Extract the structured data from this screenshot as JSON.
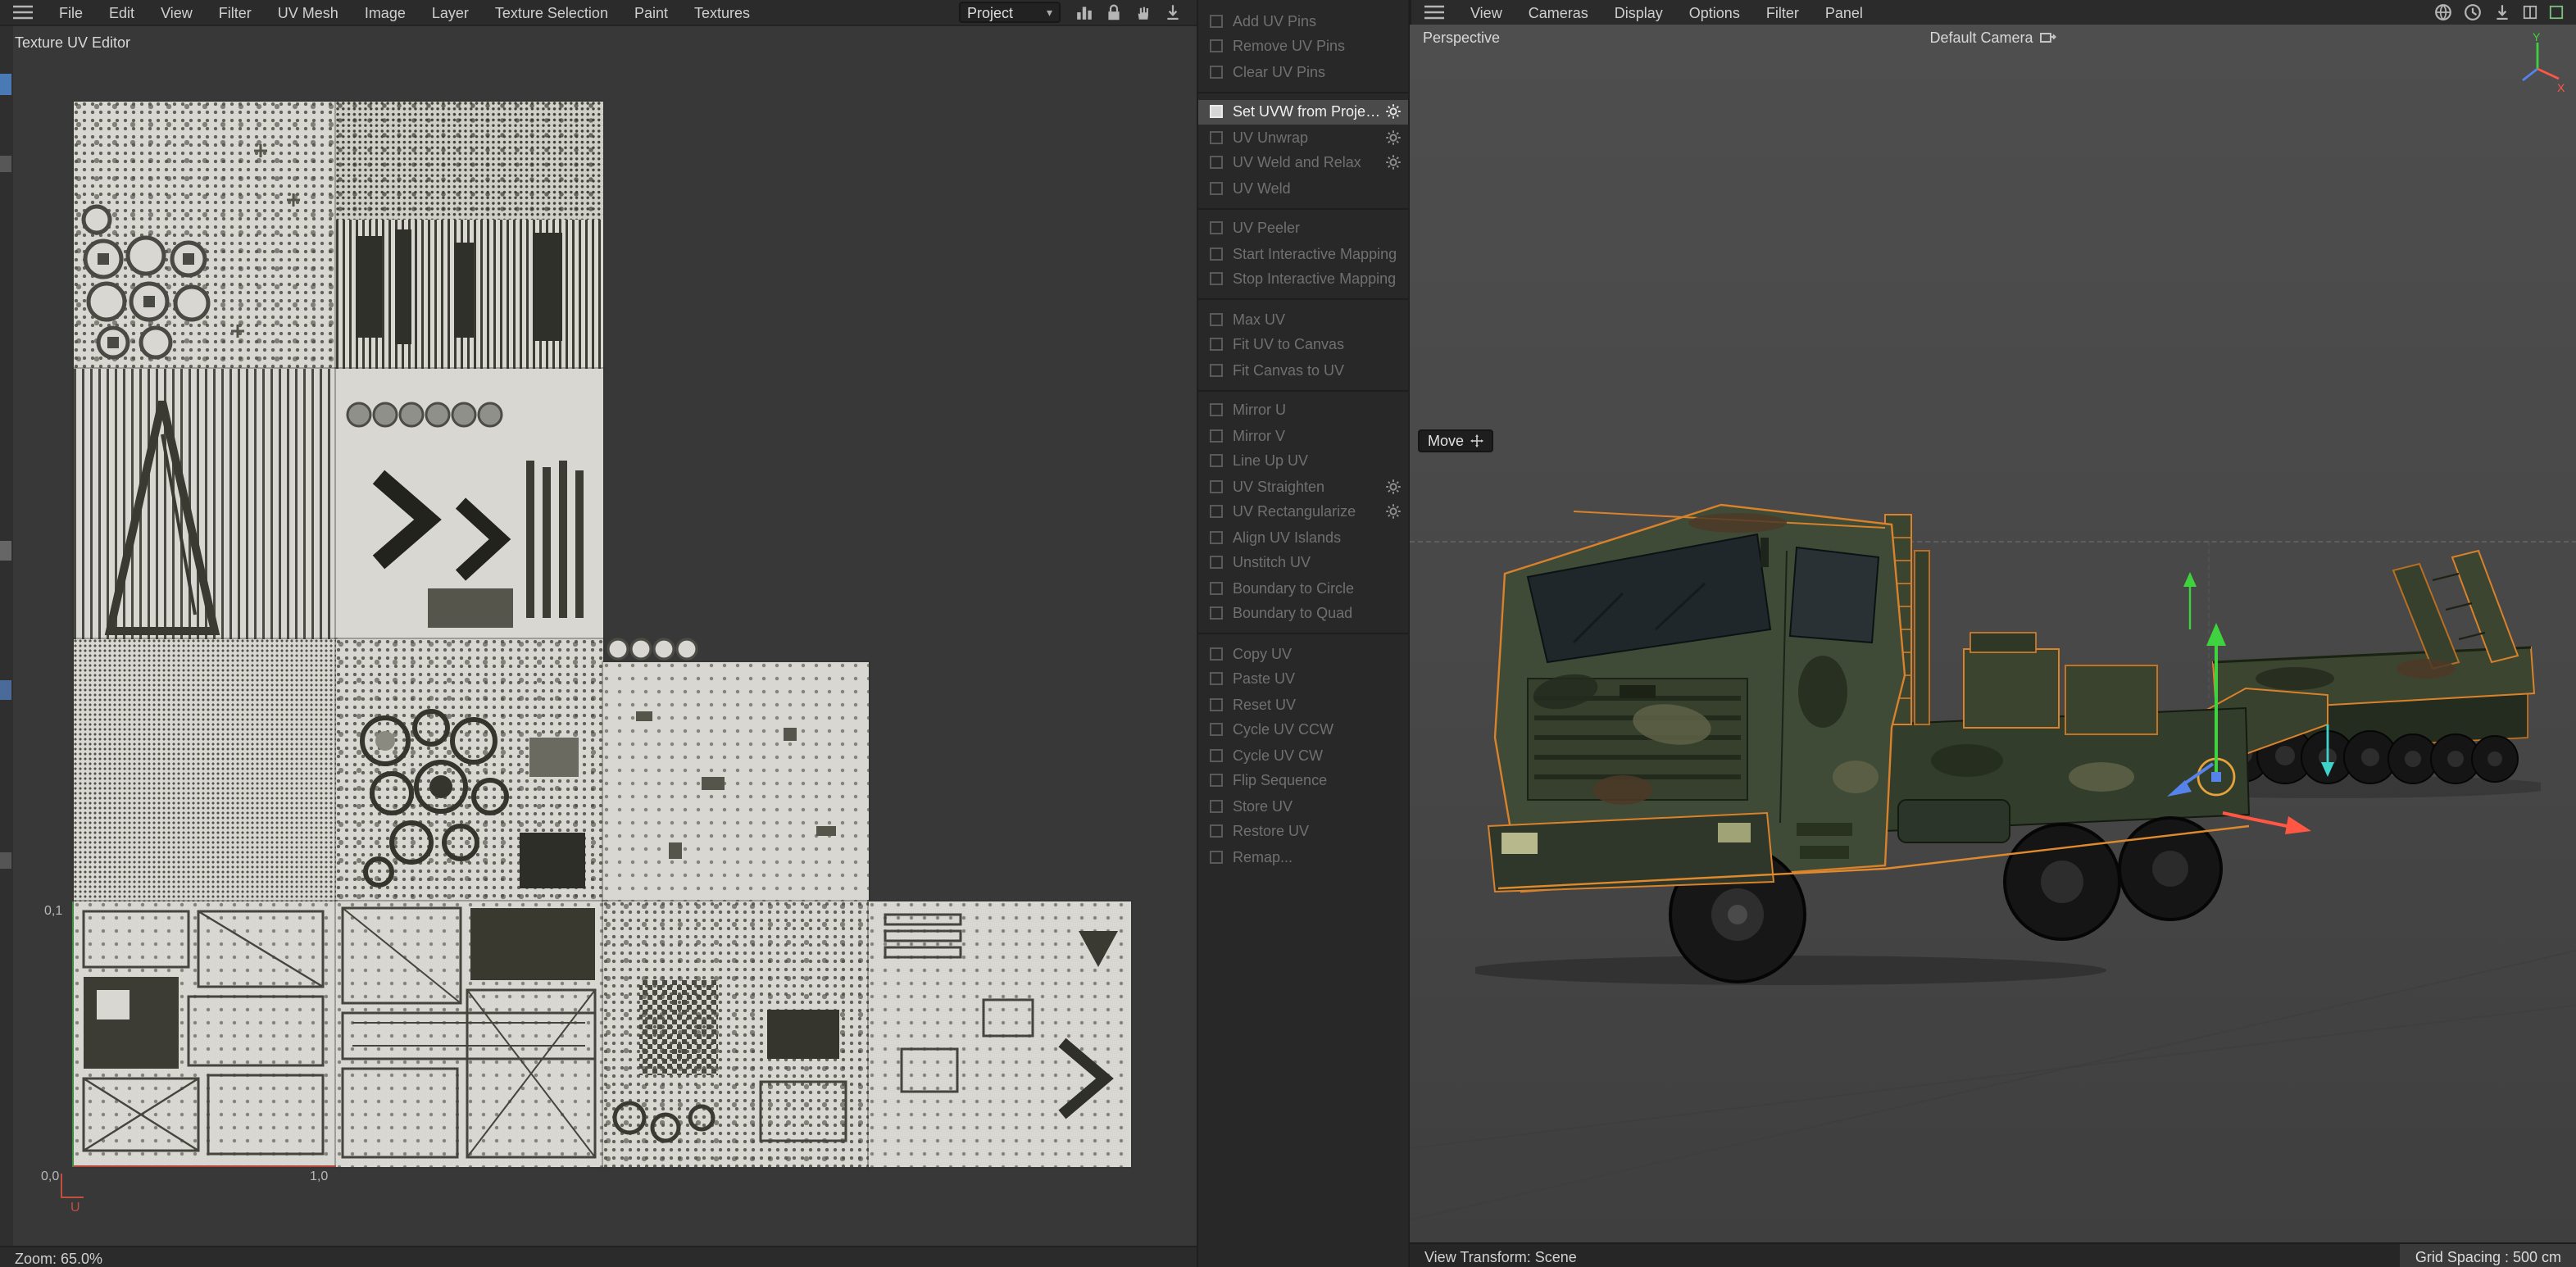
{
  "menubar_left": {
    "items": [
      "File",
      "Edit",
      "View",
      "Filter",
      "UV Mesh",
      "Image",
      "Layer",
      "Texture Selection",
      "Paint",
      "Textures"
    ],
    "project_dropdown": {
      "value": "Project",
      "chevron": "▾"
    }
  },
  "menubar_right": {
    "items": [
      "View",
      "Cameras",
      "Display",
      "Options",
      "Filter",
      "Panel"
    ]
  },
  "icons": [
    "hamburger-icon",
    "histogram-icon",
    "lock-icon",
    "pan-hand-icon",
    "load-down-icon",
    "render-globe-icon",
    "time-icon",
    "panel-split-icon",
    "panel-max-icon",
    "gear-icon",
    "camera-switch-icon",
    "move-icon"
  ],
  "uv_editor": {
    "title": "Texture UV Editor",
    "coords": {
      "top_left": "0,1",
      "origin": "0,0",
      "bottom_right": "1,0"
    },
    "axis_u_label": "U",
    "status": "Zoom: 65.0%"
  },
  "command_panel": {
    "items": [
      {
        "label": "Add UV Pins",
        "enabled": false,
        "gear": false
      },
      {
        "label": "Remove UV Pins",
        "enabled": false,
        "gear": false
      },
      {
        "label": "Clear UV Pins",
        "enabled": false,
        "gear": false
      },
      {
        "label": "Set UVW from Projection",
        "enabled": true,
        "highlighted": true,
        "gear": true
      },
      {
        "label": "UV Unwrap",
        "enabled": false,
        "gear": true
      },
      {
        "label": "UV Weld and Relax",
        "enabled": false,
        "gear": true
      },
      {
        "label": "UV Weld",
        "enabled": false,
        "gear": false
      },
      {
        "label": "UV Peeler",
        "enabled": false,
        "gear": false
      },
      {
        "label": "Start Interactive Mapping",
        "enabled": false,
        "gear": false
      },
      {
        "label": "Stop Interactive Mapping",
        "enabled": false,
        "gear": false
      },
      {
        "label": "Max UV",
        "enabled": false,
        "gear": false
      },
      {
        "label": "Fit UV to Canvas",
        "enabled": false,
        "gear": false
      },
      {
        "label": "Fit Canvas to UV",
        "enabled": false,
        "gear": false
      },
      {
        "label": "Mirror U",
        "enabled": false,
        "gear": false
      },
      {
        "label": "Mirror V",
        "enabled": false,
        "gear": false
      },
      {
        "label": "Line Up UV",
        "enabled": false,
        "gear": false
      },
      {
        "label": "UV Straighten",
        "enabled": false,
        "gear": true
      },
      {
        "label": "UV Rectangularize",
        "enabled": false,
        "gear": true
      },
      {
        "label": "Align UV Islands",
        "enabled": false,
        "gear": false
      },
      {
        "label": "Unstitch UV",
        "enabled": false,
        "gear": false
      },
      {
        "label": "Boundary to Circle",
        "enabled": false,
        "gear": false
      },
      {
        "label": "Boundary to Quad",
        "enabled": false,
        "gear": false
      },
      {
        "label": "Copy UV",
        "enabled": false,
        "gear": false
      },
      {
        "label": "Paste UV",
        "enabled": false,
        "gear": false
      },
      {
        "label": "Reset UV",
        "enabled": false,
        "gear": false
      },
      {
        "label": "Cycle UV CCW",
        "enabled": false,
        "gear": false
      },
      {
        "label": "Cycle UV CW",
        "enabled": false,
        "gear": false
      },
      {
        "label": "Flip Sequence",
        "enabled": false,
        "gear": false
      },
      {
        "label": "Store UV",
        "enabled": false,
        "gear": false
      },
      {
        "label": "Restore UV",
        "enabled": false,
        "gear": false
      },
      {
        "label": "Remap...",
        "enabled": false,
        "gear": false
      }
    ]
  },
  "viewport": {
    "view_label": "Perspective",
    "camera_label": "Default Camera",
    "move_tooltip": "Move",
    "status_left": "View Transform: Scene",
    "status_right": "Grid Spacing : 500 cm",
    "axis_gizmo": {
      "x": "X",
      "y": "Y"
    }
  },
  "colors": {
    "selection_orange": "#d9822b",
    "gizmo_green": "#3fd23f",
    "gizmo_red": "#ff5743",
    "gizmo_blue": "#5583ea",
    "axis_u_red": "#c0503c",
    "axis_v_green": "#3f8f3f",
    "highlight_row": "#4a4a4a"
  }
}
